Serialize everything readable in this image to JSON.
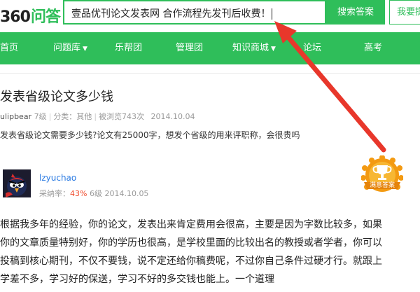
{
  "header": {
    "logo_num": "360",
    "logo_cn": "问答",
    "search_value": "壹品优刊论文发表网   合作流程先发刊后收费！",
    "search_button": "搜索答案",
    "ask_button": "我要提问"
  },
  "nav": {
    "items": [
      {
        "label": "首页"
      },
      {
        "label": "问题库"
      },
      {
        "label": "乐帮团"
      },
      {
        "label": "管理团"
      },
      {
        "label": "知识商城"
      },
      {
        "label": "论坛"
      },
      {
        "label": "高考"
      }
    ]
  },
  "question": {
    "title": "发表省级论文多少钱",
    "user": "ulipbear",
    "level": "7级",
    "category_label": "分类：其他",
    "views": "被浏览743次",
    "date": "2014.10.04",
    "description": "发表省级论文需要多少钱?论文有25000字，想发个省级的用来评职称，会很贵吗"
  },
  "answer": {
    "user": "lzyuchao",
    "rate_label": "采纳率：",
    "rate_value": "43%",
    "level": "6级",
    "date": "2014.10.05",
    "badge_label": "满意答案",
    "lines": [
      "根据我多年的经验，你的论文，发表出来肯定费用会很高，主要是因为字数比较多，如果",
      "你的文章质量特别好，你的学历也很高，是学校里面的比较出名的教授或者学者，你可以",
      "投稿到核心期刊，不仅不要钱，说不定还给你稿费呢，不过你自己条件过硬才行。就跟上",
      "学差不多，学习好的保送，学习不好的多交钱也能上。一个道理"
    ]
  },
  "colors": {
    "brand_green": "#2fbe5a",
    "arrow_red": "#e8372b",
    "badge_gold": "#f39a12"
  }
}
